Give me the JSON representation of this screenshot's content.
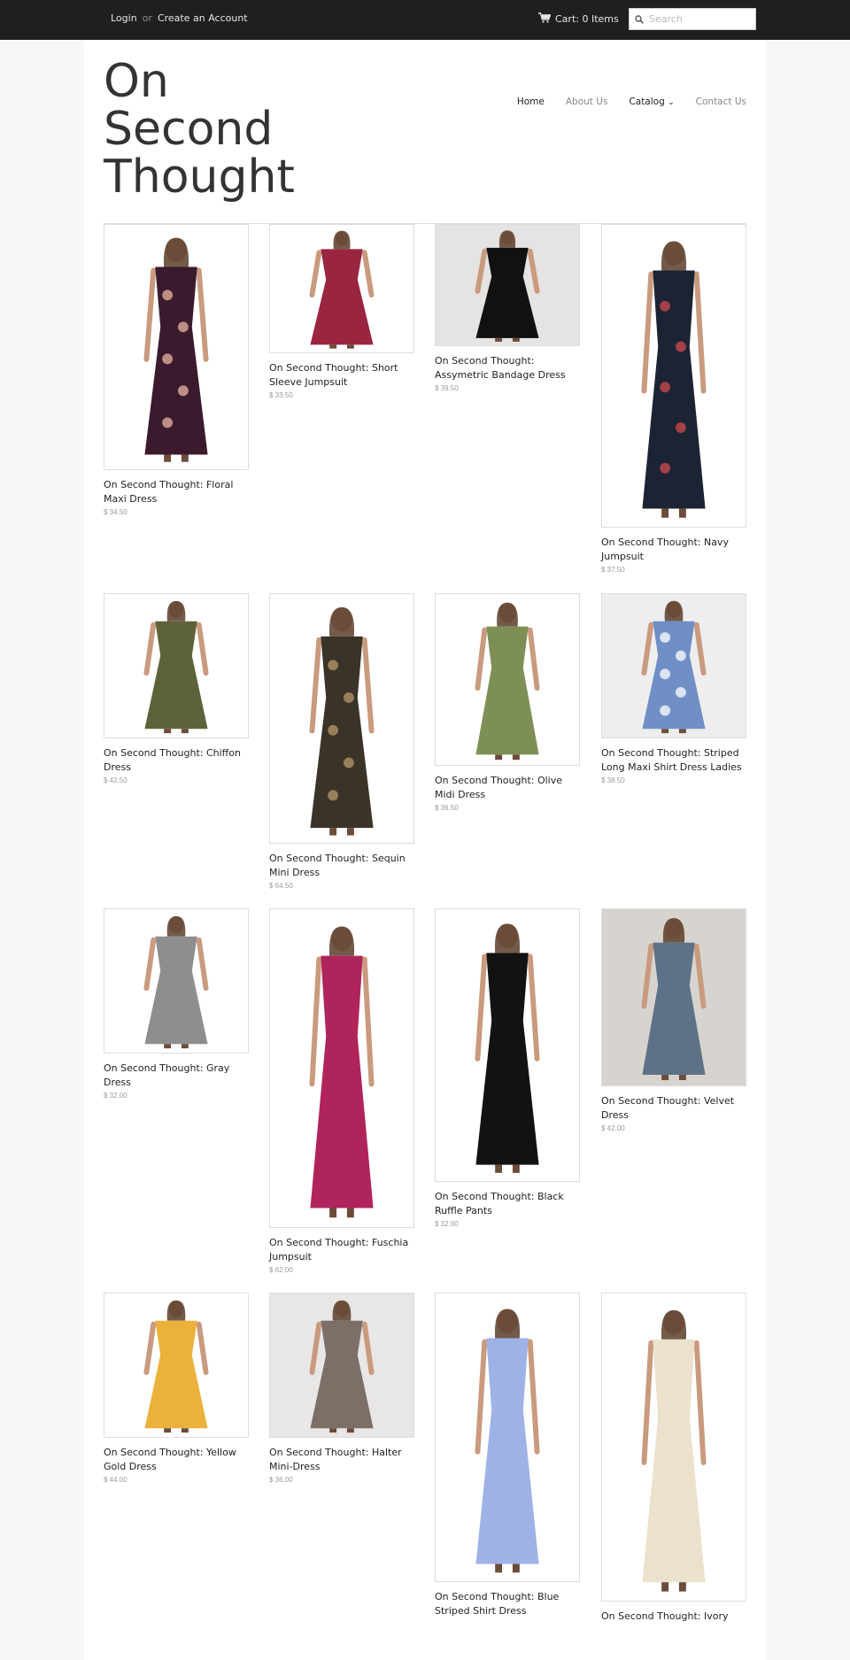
{
  "topbar": {
    "login": "Login",
    "or": "or",
    "create": "Create an Account",
    "cart": "Cart: 0 Items",
    "search_placeholder": "Search"
  },
  "logo": "On Second Thought",
  "nav": {
    "home": "Home",
    "about": "About Us",
    "catalog": "Catalog",
    "contact": "Contact Us"
  },
  "products": [
    {
      "name": "On Second Thought: Floral Maxi Dress",
      "price": "$ 34.50",
      "color": "#3b1a2e",
      "accent": "#e8b7a0",
      "bg": "#ffffff"
    },
    {
      "name": "On Second Thought: Short Sleeve Jumpsuit",
      "price": "$ 33.50",
      "color": "#9a2540",
      "accent": "#9a2540",
      "bg": "#ffffff"
    },
    {
      "name": "On Second Thought: Assymetric Bandage Dress",
      "price": "$ 39.50",
      "color": "#111111",
      "accent": "#111111",
      "bg": "#e6e4e2"
    },
    {
      "name": "On Second Thought: Navy Jumpsuit",
      "price": "$ 37.50",
      "color": "#1c2433",
      "accent": "#d24a4f",
      "bg": "#ffffff"
    },
    {
      "name": "On Second Thought: Chiffon Dress",
      "price": "$ 42.50",
      "color": "#5e6238",
      "accent": "#5e6238",
      "bg": "#ffffff"
    },
    {
      "name": "On Second Thought: Sequin Mini Dress",
      "price": "$ 64.50",
      "color": "#3a3328",
      "accent": "#b89a6a",
      "bg": "#ffffff"
    },
    {
      "name": "On Second Thought: Olive Midi Dress",
      "price": "$ 36.50",
      "color": "#7e8f55",
      "accent": "#7e8f55",
      "bg": "#ffffff"
    },
    {
      "name": "On Second Thought: Striped Long Maxi Shirt Dress Ladies",
      "price": "$ 38.50",
      "color": "#6f8fc6",
      "accent": "#ffffff",
      "bg": "#eeeeee"
    },
    {
      "name": "On Second Thought: Gray Dress",
      "price": "$ 32.00",
      "color": "#8e8e8e",
      "accent": "#8e8e8e",
      "bg": "#ffffff"
    },
    {
      "name": "On Second Thought: Fuschia Jumpsuit",
      "price": "$ 62.00",
      "color": "#b0245c",
      "accent": "#b0245c",
      "bg": "#ffffff"
    },
    {
      "name": "On Second Thought: Black Ruffle Pants",
      "price": "$ 32.00",
      "color": "#121212",
      "accent": "#121212",
      "bg": "#ffffff"
    },
    {
      "name": "On Second Thought: Velvet Dress",
      "price": "$ 42.00",
      "color": "#5d7286",
      "accent": "#5d7286",
      "bg": "#d7d4cf"
    },
    {
      "name": "On Second Thought: Yellow Gold Dress",
      "price": "$ 44.00",
      "color": "#eab23a",
      "accent": "#eab23a",
      "bg": "#ffffff"
    },
    {
      "name": "On Second Thought: Halter Mini-Dress",
      "price": "$ 36.00",
      "color": "#7c6f68",
      "accent": "#7c6f68",
      "bg": "#e9e6e6"
    },
    {
      "name": "On Second Thought: Blue Striped Shirt Dress",
      "price": "",
      "color": "#9fb2e6",
      "accent": "#9fb2e6",
      "bg": "#ffffff"
    },
    {
      "name": "On Second Thought: Ivory",
      "price": "",
      "color": "#ece1cc",
      "accent": "#ece1cc",
      "bg": "#ffffff"
    }
  ]
}
